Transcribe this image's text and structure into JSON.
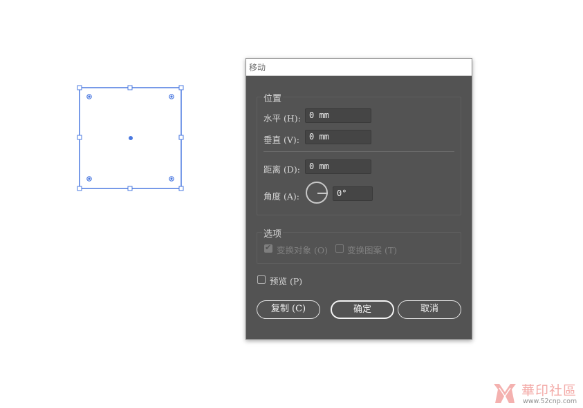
{
  "dialog": {
    "title": "移动",
    "position_group": {
      "label": "位置",
      "horizontal": {
        "label": "水平 (H):",
        "value": "0 mm"
      },
      "vertical": {
        "label": "垂直 (V):",
        "value": "0 mm"
      },
      "distance": {
        "label": "距离 (D):",
        "value": "0 mm"
      },
      "angle": {
        "label": "角度 (A):",
        "value": "0°"
      }
    },
    "options_group": {
      "label": "选项",
      "transform_objects": {
        "label": "变换对象 (O)",
        "checked": true,
        "enabled": false
      },
      "transform_patterns": {
        "label": "变换图案 (T)",
        "checked": false,
        "enabled": false
      }
    },
    "preview": {
      "label": "预览 (P)",
      "checked": false
    },
    "buttons": {
      "copy": "复制 (C)",
      "ok": "确定",
      "cancel": "取消"
    }
  },
  "watermark": {
    "title": "華印社區",
    "url": "www.52cnp.com"
  },
  "colors": {
    "selection": "#4a78e0",
    "dialog_bg": "#535353",
    "watermark_pink": "#f3a9a6"
  }
}
